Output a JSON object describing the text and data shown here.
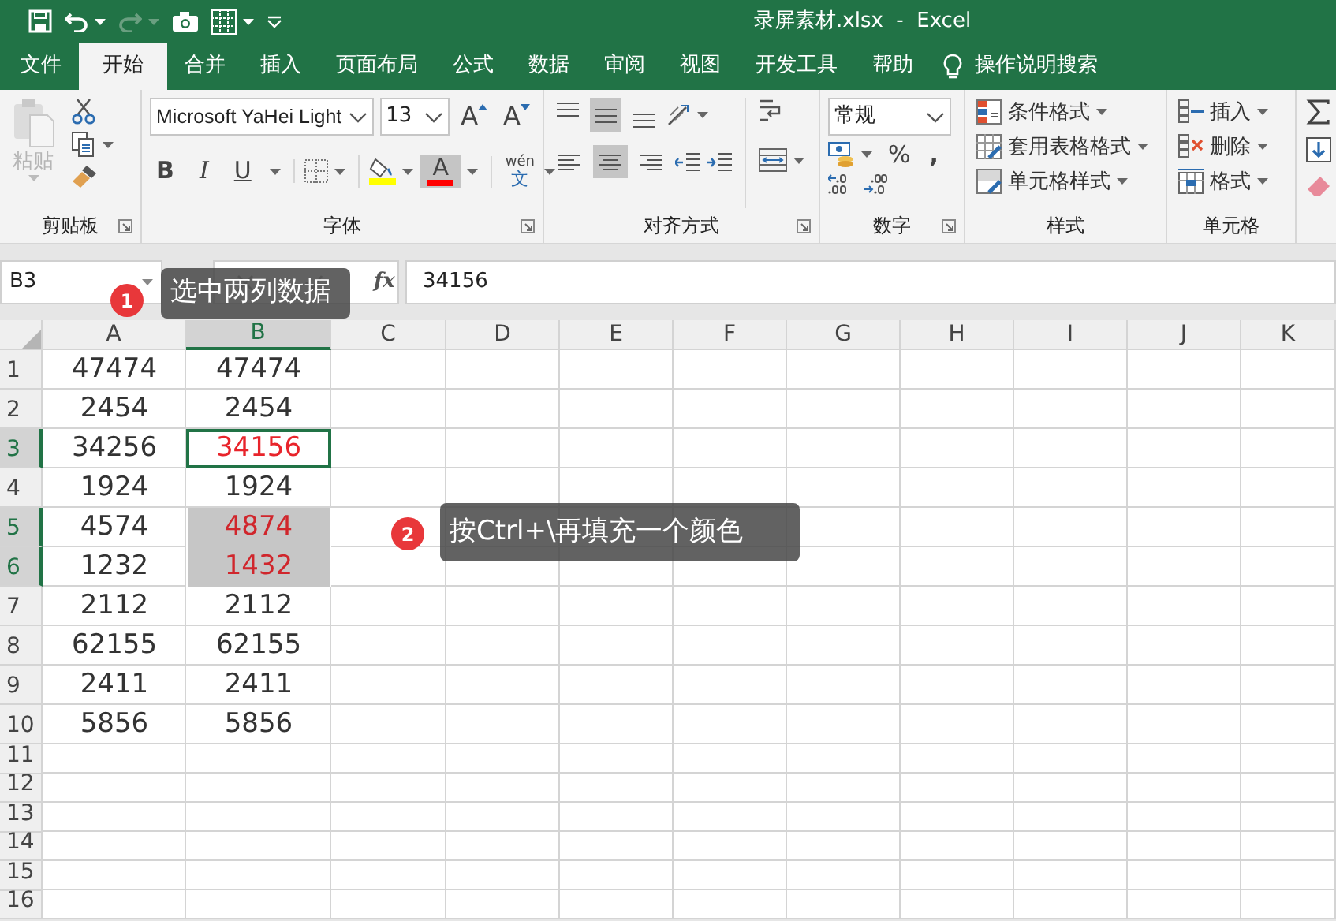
{
  "window": {
    "title": "录屏素材.xlsx  -  Excel"
  },
  "quick_access": {
    "redo_disabled": true
  },
  "tabs": [
    {
      "label": "文件",
      "selected": false
    },
    {
      "label": "开始",
      "selected": true
    },
    {
      "label": "合并",
      "selected": false
    },
    {
      "label": "插入",
      "selected": false
    },
    {
      "label": "页面布局",
      "selected": false
    },
    {
      "label": "公式",
      "selected": false
    },
    {
      "label": "数据",
      "selected": false
    },
    {
      "label": "审阅",
      "selected": false
    },
    {
      "label": "视图",
      "selected": false
    },
    {
      "label": "开发工具",
      "selected": false
    },
    {
      "label": "帮助",
      "selected": false
    }
  ],
  "tell_me": "操作说明搜索",
  "ribbon": {
    "clipboard": {
      "paste": "粘贴",
      "paste_disabled": true,
      "label": "剪贴板"
    },
    "font": {
      "name": "Microsoft YaHei Light",
      "size": "13",
      "grow": "A",
      "shrink": "A",
      "bold": "B",
      "italic": "I",
      "underline": "U",
      "font_color": "A",
      "phonetic_top": "wén",
      "phonetic_bottom": "文",
      "label": "字体"
    },
    "alignment": {
      "vertical": [
        {
          "selected": false
        },
        {
          "selected": true
        },
        {
          "selected": false
        }
      ],
      "horizontal": [
        {
          "selected": false
        },
        {
          "selected": true
        },
        {
          "selected": false
        }
      ],
      "label": "对齐方式"
    },
    "number": {
      "format": "常规",
      "percent": "%",
      "comma": ",",
      "label": "数字"
    },
    "styles": {
      "items": [
        "条件格式",
        "套用表格格式",
        "单元格样式"
      ],
      "label": "样式"
    },
    "cells": {
      "items": [
        "插入",
        "删除",
        "格式"
      ],
      "label": "单元格"
    }
  },
  "formula_bar": {
    "name_box": "B3",
    "fx": "fx",
    "value": "34156"
  },
  "sheet": {
    "columns": [
      {
        "label": "A",
        "selected": false
      },
      {
        "label": "B",
        "selected": true
      },
      {
        "label": "C",
        "selected": false
      },
      {
        "label": "D",
        "selected": false
      },
      {
        "label": "E",
        "selected": false
      },
      {
        "label": "F",
        "selected": false
      },
      {
        "label": "G",
        "selected": false
      },
      {
        "label": "H",
        "selected": false
      },
      {
        "label": "I",
        "selected": false
      },
      {
        "label": "J",
        "selected": false
      },
      {
        "label": "K",
        "selected": false
      }
    ],
    "rows": [
      {
        "label": "1",
        "selected": false,
        "a": "47474",
        "b": "47474",
        "b_active": false,
        "b_filled": false
      },
      {
        "label": "2",
        "selected": false,
        "a": "2454",
        "b": "2454",
        "b_active": false,
        "b_filled": false
      },
      {
        "label": "3",
        "selected": true,
        "a": "34256",
        "b": "34156",
        "b_active": true,
        "b_filled": false
      },
      {
        "label": "4",
        "selected": false,
        "a": "1924",
        "b": "1924",
        "b_active": false,
        "b_filled": false
      },
      {
        "label": "5",
        "selected": true,
        "a": "4574",
        "b": "4874",
        "b_active": false,
        "b_filled": true
      },
      {
        "label": "6",
        "selected": true,
        "a": "1232",
        "b": "1432",
        "b_active": false,
        "b_filled": true
      },
      {
        "label": "7",
        "selected": false,
        "a": "2112",
        "b": "2112",
        "b_active": false,
        "b_filled": false
      },
      {
        "label": "8",
        "selected": false,
        "a": "62155",
        "b": "62155",
        "b_active": false,
        "b_filled": false
      },
      {
        "label": "9",
        "selected": false,
        "a": "2411",
        "b": "2411",
        "b_active": false,
        "b_filled": false
      },
      {
        "label": "10",
        "selected": false,
        "a": "5856",
        "b": "5856",
        "b_active": false,
        "b_filled": false
      },
      {
        "label": "11",
        "selected": false
      },
      {
        "label": "12",
        "selected": false
      },
      {
        "label": "13",
        "selected": false
      },
      {
        "label": "14",
        "selected": false
      },
      {
        "label": "15",
        "selected": false
      },
      {
        "label": "16",
        "selected": false
      }
    ]
  },
  "callouts": [
    {
      "number": "1",
      "text": "选中两列数据"
    },
    {
      "number": "2",
      "text": "按Ctrl+\\再填充一个颜色"
    }
  ]
}
